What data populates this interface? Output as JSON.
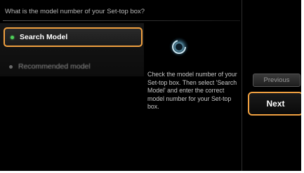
{
  "question": "What is the model number of your Set-top box?",
  "options": [
    {
      "label": "Search Model",
      "selected": true
    },
    {
      "label": "Recommended model",
      "selected": false
    }
  ],
  "help_text": "Check the model number of your Set-top box. Then select 'Search Model' and enter the correct model number for your Set-top box.",
  "buttons": {
    "previous": "Previous",
    "next": "Next"
  },
  "colors": {
    "focus_highlight": "#f0a040",
    "selected_bullet": "#4fd05a",
    "spinner_glow": "#7fd8ff"
  },
  "icons": {
    "loading": "loading-spinner-icon"
  }
}
